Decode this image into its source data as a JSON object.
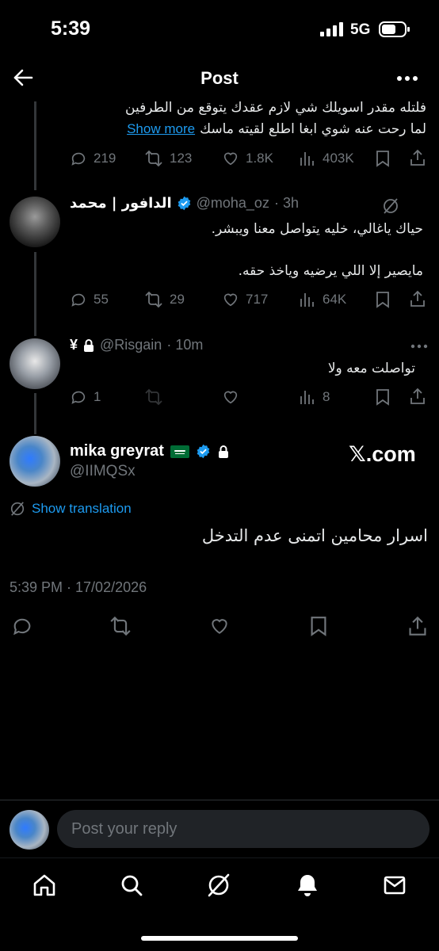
{
  "status": {
    "time": "5:39",
    "network": "5G"
  },
  "header": {
    "title": "Post"
  },
  "reply0": {
    "text_line1": "فلتله مقدر اسويلك شي لازم عقدك يتوقع من الطرفين",
    "text_line2": "لما رحت عنه شوي ابغا اطلع لقيته ماسك",
    "show_more": "Show more",
    "stats": {
      "replies": "219",
      "reposts": "123",
      "likes": "1.8K",
      "views": "403K"
    }
  },
  "reply1": {
    "name": "الدافور | محمد",
    "handle": "@moha_oz",
    "time": "· 3h",
    "text_line1": "حياك ياغالي، خليه يتواصل معنا ويبشر.",
    "text_line2": "مايصير إلا اللي يرضيه وياخذ حقه.",
    "stats": {
      "replies": "55",
      "reposts": "29",
      "likes": "717",
      "views": "64K"
    }
  },
  "reply2": {
    "name": "¥",
    "handle": "@Risgain",
    "time": "· 10m",
    "text": "تواصلت معه ولا",
    "stats": {
      "replies": "1",
      "reposts": "",
      "likes": "",
      "views": "8"
    }
  },
  "main_post": {
    "name": "mika greyrat",
    "flag": "🇸🇦",
    "handle": "@IIMQSx",
    "watermark": "𝕏.com",
    "show_translation": "Show translation",
    "text": "اسرار محامين اتمنى عدم التدخل",
    "timestamp": "5:39 PM · 17/02/2026"
  },
  "reply_bar": {
    "placeholder": "Post your reply"
  },
  "colors": {
    "accent": "#1d9bf0",
    "background": "#000000",
    "muted": "#71767b",
    "saudi_green": "#006c35"
  }
}
